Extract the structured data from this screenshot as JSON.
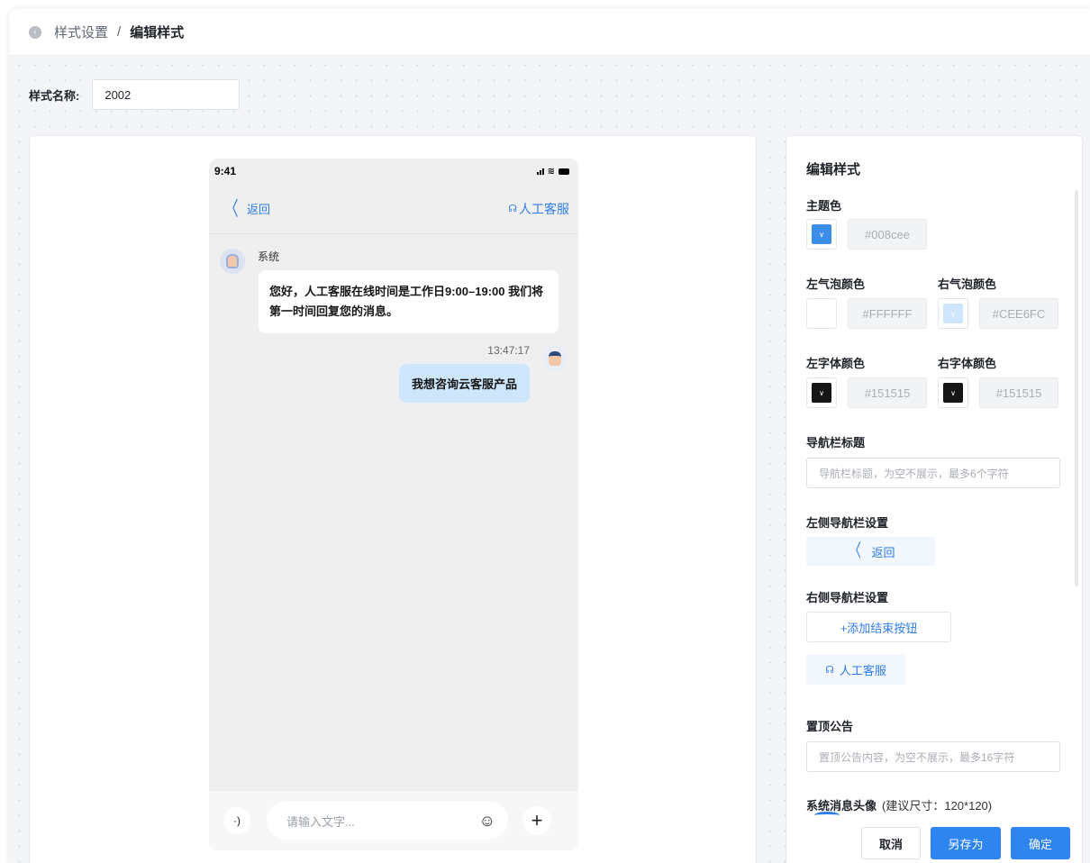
{
  "breadcrumb": {
    "parent": "样式设置",
    "separator": "/",
    "current": "编辑样式"
  },
  "style_name": {
    "label": "样式名称:",
    "value": "2002"
  },
  "phone": {
    "time": "9:41",
    "nav_back": "返回",
    "nav_agent": "人工客服",
    "sys_name": "系统",
    "sys_message": "您好，人工客服在线时间是工作日9:00–19:00 我们将第一时间回复您的消息。",
    "msg_time": "13:47:17",
    "user_message": "我想咨询云客服产品",
    "input_placeholder": "请输入文字..."
  },
  "panel": {
    "title": "编辑样式",
    "theme_color_label": "主题色",
    "theme_color": "#008cee",
    "theme_color_display": "#008cee",
    "left_bubble_label": "左气泡颜色",
    "left_bubble_color": "#FFFFFF",
    "right_bubble_label": "右气泡颜色",
    "right_bubble_color": "#CEE6FC",
    "right_bubble_display": "#CEE6FC",
    "left_font_label": "左字体颜色",
    "left_font_color": "#151515",
    "right_font_label": "右字体颜色",
    "right_font_color": "#151515",
    "nav_title_label": "导航栏标题",
    "nav_title_placeholder": "导航栏标题，为空不展示，最多6个字符",
    "left_nav_label": "左侧导航栏设置",
    "left_nav_chip": "返回",
    "right_nav_label": "右侧导航栏设置",
    "add_end_button": "+添加结束按钮",
    "agent_chip": "人工客服",
    "notice_label": "置顶公告",
    "notice_placeholder": "置顶公告内容，为空不展示，最多16字符",
    "sys_avatar_label": "系统消息头像",
    "sys_avatar_hint": "(建议尺寸：120*120)"
  },
  "actions": {
    "cancel": "取消",
    "save_as": "另存为",
    "confirm": "确定"
  },
  "colors": {
    "accent": "#2f85f0",
    "link": "#2f7ee6"
  }
}
